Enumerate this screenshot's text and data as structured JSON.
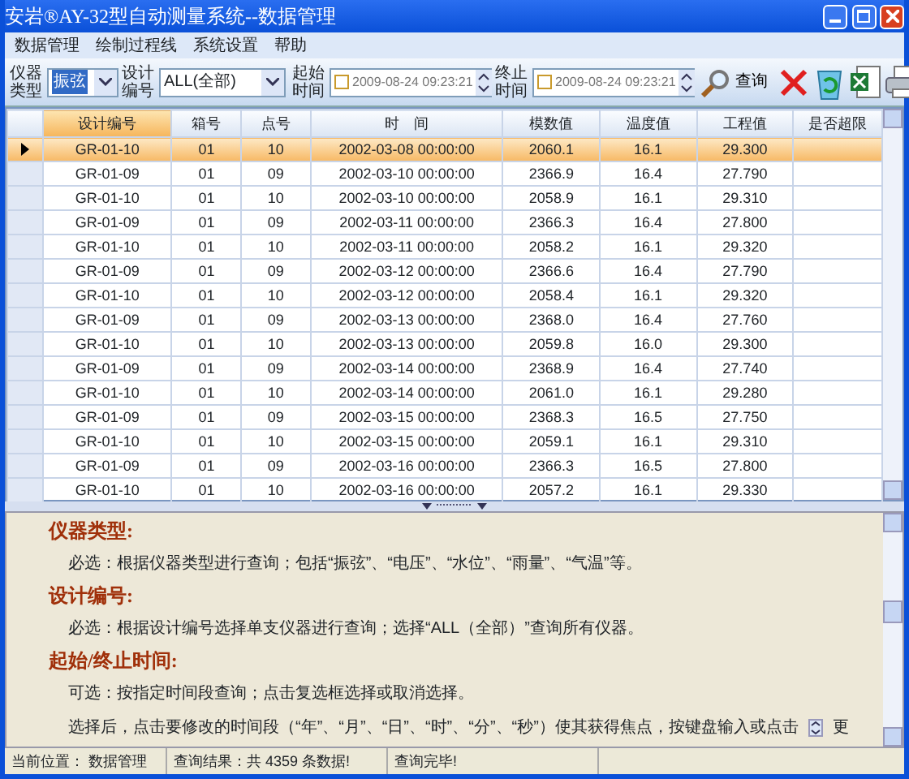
{
  "window": {
    "title": "安岩®AY-32型自动测量系统--数据管理"
  },
  "menu": [
    "数据管理",
    "绘制过程线",
    "系统设置",
    "帮助"
  ],
  "toolbar": {
    "instrument_type": {
      "label": "仪器类型",
      "value": "振弦"
    },
    "design_number": {
      "label": "设计编号",
      "value": "ALL(全部)"
    },
    "start_time": {
      "label": "起始时间",
      "value": "2009-08-24 09:23:21",
      "checked": false
    },
    "end_time": {
      "label": "终止时间",
      "value": "2009-08-24 09:23:21",
      "checked": false
    },
    "query_button": "查询"
  },
  "table": {
    "columns": [
      "设计编号",
      "箱号",
      "点号",
      "时　间",
      "模数值",
      "温度值",
      "工程值",
      "是否超限"
    ],
    "rows": [
      {
        "selected": true,
        "cells": [
          "GR-01-10",
          "01",
          "10",
          "2002-03-08 00:00:00",
          "2060.1",
          "16.1",
          "29.300"
        ]
      },
      {
        "selected": false,
        "cells": [
          "GR-01-09",
          "01",
          "09",
          "2002-03-10 00:00:00",
          "2366.9",
          "16.4",
          "27.790"
        ]
      },
      {
        "selected": false,
        "cells": [
          "GR-01-10",
          "01",
          "10",
          "2002-03-10 00:00:00",
          "2058.9",
          "16.1",
          "29.310"
        ]
      },
      {
        "selected": false,
        "cells": [
          "GR-01-09",
          "01",
          "09",
          "2002-03-11 00:00:00",
          "2366.3",
          "16.4",
          "27.800"
        ]
      },
      {
        "selected": false,
        "cells": [
          "GR-01-10",
          "01",
          "10",
          "2002-03-11 00:00:00",
          "2058.2",
          "16.1",
          "29.320"
        ]
      },
      {
        "selected": false,
        "cells": [
          "GR-01-09",
          "01",
          "09",
          "2002-03-12 00:00:00",
          "2366.6",
          "16.4",
          "27.790"
        ]
      },
      {
        "selected": false,
        "cells": [
          "GR-01-10",
          "01",
          "10",
          "2002-03-12 00:00:00",
          "2058.4",
          "16.1",
          "29.320"
        ]
      },
      {
        "selected": false,
        "cells": [
          "GR-01-09",
          "01",
          "09",
          "2002-03-13 00:00:00",
          "2368.0",
          "16.4",
          "27.760"
        ]
      },
      {
        "selected": false,
        "cells": [
          "GR-01-10",
          "01",
          "10",
          "2002-03-13 00:00:00",
          "2059.8",
          "16.0",
          "29.300"
        ]
      },
      {
        "selected": false,
        "cells": [
          "GR-01-09",
          "01",
          "09",
          "2002-03-14 00:00:00",
          "2368.9",
          "16.4",
          "27.740"
        ]
      },
      {
        "selected": false,
        "cells": [
          "GR-01-10",
          "01",
          "10",
          "2002-03-14 00:00:00",
          "2061.0",
          "16.1",
          "29.280"
        ]
      },
      {
        "selected": false,
        "cells": [
          "GR-01-09",
          "01",
          "09",
          "2002-03-15 00:00:00",
          "2368.3",
          "16.5",
          "27.750"
        ]
      },
      {
        "selected": false,
        "cells": [
          "GR-01-10",
          "01",
          "10",
          "2002-03-15 00:00:00",
          "2059.1",
          "16.1",
          "29.310"
        ]
      },
      {
        "selected": false,
        "cells": [
          "GR-01-09",
          "01",
          "09",
          "2002-03-16 00:00:00",
          "2366.3",
          "16.5",
          "27.800"
        ]
      },
      {
        "selected": false,
        "cells": [
          "GR-01-10",
          "01",
          "10",
          "2002-03-16 00:00:00",
          "2057.2",
          "16.1",
          "29.330"
        ]
      }
    ]
  },
  "help": [
    {
      "kind": "heading",
      "text": "仪器类型:"
    },
    {
      "kind": "para",
      "text": "必选：根据仪器类型进行查询；包括“振弦”、“电压”、“水位”、“雨量”、“气温”等。"
    },
    {
      "kind": "heading",
      "text": "设计编号:"
    },
    {
      "kind": "para",
      "text": "必选：根据设计编号选择单支仪器进行查询；选择“ALL（全部）”查询所有仪器。"
    },
    {
      "kind": "heading",
      "text": "起始/终止时间:"
    },
    {
      "kind": "para",
      "text": "可选：按指定时间段查询；点击复选框选择或取消选择。"
    },
    {
      "kind": "para",
      "text": "选择后，点击要修改的时间段（“年”、“月”、“日”、“时”、“分”、“秒”）使其获得焦点，按键盘输入或点击",
      "more": "更"
    }
  ],
  "status_bar": [
    "当前位置：  数据管理",
    "查询结果：共 4359 条数据!",
    "查询完毕!"
  ]
}
